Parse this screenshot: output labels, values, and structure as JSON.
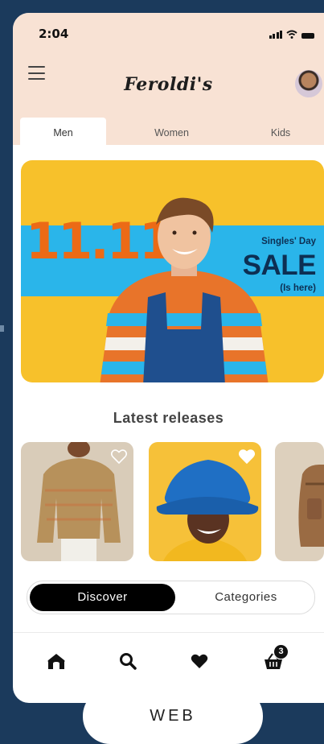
{
  "status_bar": {
    "time": "2:04"
  },
  "header": {
    "logo": "Feroldi's"
  },
  "tabs": [
    {
      "label": "Men",
      "active": true
    },
    {
      "label": "Women",
      "active": false
    },
    {
      "label": "Kids",
      "active": false
    }
  ],
  "banner": {
    "headline": "11.11",
    "small_text": "Singles' Day",
    "big_text": "SALE",
    "sub_text": "(Is here)",
    "colors": {
      "yellow": "#f7c12b",
      "blue": "#2ab5ea",
      "orange": "#ec6a16",
      "navy": "#0d2f53"
    }
  },
  "latest": {
    "title": "Latest releases",
    "products": [
      {
        "name": "sweater",
        "favorited": false
      },
      {
        "name": "bucket-hat",
        "favorited": true
      },
      {
        "name": "backpack",
        "favorited": false
      }
    ]
  },
  "segmented": {
    "discover": "Discover",
    "categories": "Categories",
    "selected": "Discover"
  },
  "bottom_nav": {
    "items": [
      "home-icon",
      "search-icon",
      "heart-icon",
      "cart-icon"
    ],
    "cart_count": "3"
  },
  "footer": {
    "label": "WEB"
  }
}
